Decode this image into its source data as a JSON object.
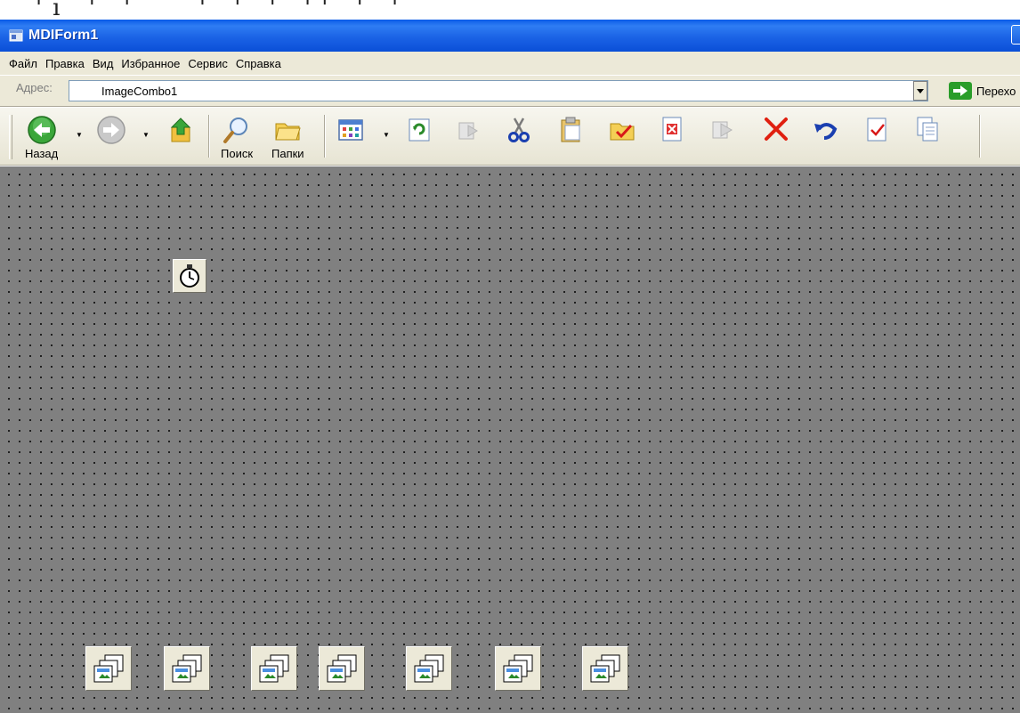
{
  "window": {
    "title": "MDIForm1"
  },
  "menu": [
    {
      "label": "Файл"
    },
    {
      "label": "Правка"
    },
    {
      "label": "Вид"
    },
    {
      "label": "Избранное"
    },
    {
      "label": "Сервис"
    },
    {
      "label": "Справка"
    }
  ],
  "address": {
    "label": "Адрес:",
    "value": "ImageCombo1",
    "go_label": "Перехо"
  },
  "toolbar": {
    "back_label": "Назад",
    "search_label": "Поиск",
    "folders_label": "Папки"
  },
  "icons": {
    "back": "green-back-arrow-icon",
    "forward": "forward-arrow-icon",
    "up": "up-folder-icon",
    "search": "magnifier-icon",
    "folders": "folders-icon",
    "views": "views-icon",
    "refresh": "refresh-icon",
    "cut": "scissors-icon",
    "paste": "clipboard-icon",
    "delete": "red-x-icon",
    "undo": "undo-icon",
    "timer": "stopwatch-icon",
    "imagelist": "imagelist-icon"
  },
  "colors": {
    "titlebar": "#0a5be7",
    "chrome": "#ece9d8",
    "canvas": "#808080",
    "delete_red": "#e02010",
    "go_green": "#2a9d2a"
  }
}
